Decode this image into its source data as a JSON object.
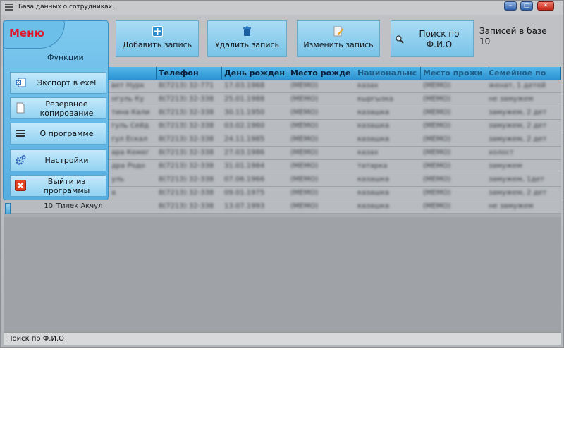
{
  "window": {
    "title": "База данных о сотрудниках."
  },
  "toolbar": {
    "add_label": "Добавить запись",
    "delete_label": "Удалить запись",
    "edit_label": "Изменить запись",
    "search_label": "Поиск по Ф.И.О",
    "records_label": "Записей в базе",
    "records_count": "10"
  },
  "menu": {
    "title": "Меню",
    "section": "Функции",
    "items": [
      {
        "label": "Экспорт в exel",
        "icon": "excel-icon"
      },
      {
        "label": "Резервное копирование",
        "icon": "document-icon"
      },
      {
        "label": "О программе",
        "icon": "list-icon"
      },
      {
        "label": "Настройки",
        "icon": "gear-icon"
      },
      {
        "label": "Выйти из программы",
        "icon": "close-icon"
      }
    ]
  },
  "grid": {
    "columns": [
      "Телефон",
      "День рожден",
      "Место рожде",
      "Национальнс",
      "Место прожи",
      "Семейное по"
    ],
    "last_row": {
      "num": "10",
      "name": "Тилек Акчул"
    },
    "rows": [
      {
        "name": "вет Нурк",
        "phone": "8(7213) 32-771",
        "bday": "17.03.1968",
        "place": "(MEMO)",
        "nat": "казах",
        "live": "(MEMO)",
        "family": "женат, 1 детей"
      },
      {
        "name": "нгуль Ку",
        "phone": "8(7213) 32-338",
        "bday": "25.01.1988",
        "place": "(MEMO)",
        "nat": "кыргызка",
        "live": "(MEMO)",
        "family": "не замужем"
      },
      {
        "name": "тина Кали",
        "phone": "8(7213) 32-338",
        "bday": "30.11.1950",
        "place": "(MEMO)",
        "nat": "казашка",
        "live": "(MEMO)",
        "family": "замужем, 2 дет"
      },
      {
        "name": "гуль Сейд",
        "phone": "8(7213) 32-338",
        "bday": "03.02.1960",
        "place": "(MEMO)",
        "nat": "казашка",
        "live": "(MEMO)",
        "family": "замужем, 2 дет"
      },
      {
        "name": "гул Ескал",
        "phone": "8(7213) 32-338",
        "bday": "24.11.1985",
        "place": "(MEMO)",
        "nat": "казашка",
        "live": "(MEMO)",
        "family": "замужем, 2 дет"
      },
      {
        "name": "ара Кемег",
        "phone": "8(7213) 32-338",
        "bday": "27.03.1986",
        "place": "(MEMO)",
        "nat": "казах",
        "live": "(MEMO)",
        "family": "холост"
      },
      {
        "name": "дра Родо",
        "phone": "8(7213) 32-338",
        "bday": "31.01.1984",
        "place": "(MEMO)",
        "nat": "татарка",
        "live": "(MEMO)",
        "family": "замужем"
      },
      {
        "name": "уль",
        "phone": "8(7213) 32-338",
        "bday": "07.06.1966",
        "place": "(MEMO)",
        "nat": "казашка",
        "live": "(MEMO)",
        "family": "замужем, 1дет"
      },
      {
        "name": "а",
        "phone": "8(7213) 32-338",
        "bday": "09.01.1975",
        "place": "(MEMO)",
        "nat": "казашка",
        "live": "(MEMO)",
        "family": "замужем, 2 дет"
      },
      {
        "name": "Тилек Акчул",
        "phone": "8(7213) 32-338",
        "bday": "13.07.1993",
        "place": "(MEMO)",
        "nat": "казашка",
        "live": "(MEMO)",
        "family": "не замужем"
      }
    ]
  },
  "status": {
    "text": "Поиск по Ф.И.О"
  }
}
